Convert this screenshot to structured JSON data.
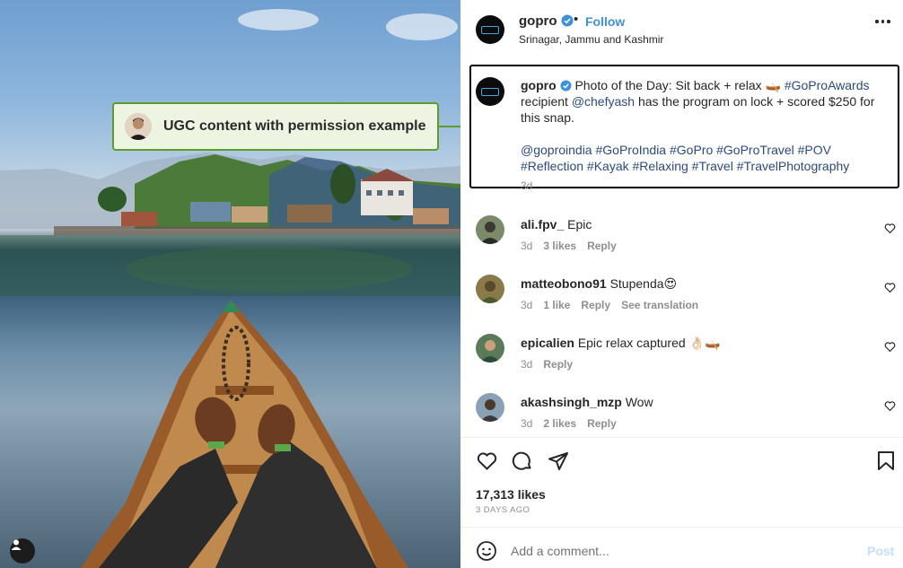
{
  "callout": {
    "text": "UGC content with permission example"
  },
  "post": {
    "username": "gopro",
    "follow_label": "Follow",
    "separator": "•",
    "location": "Srinagar, Jammu and Kashmir",
    "caption": {
      "username": "gopro",
      "text_1": "Photo of the Day: Sit back + relax",
      "emoji_1": "🛶",
      "tag_1": "#GoProAwards",
      "text_2": "recipient",
      "mention": "@chefyash",
      "text_3": "has the program on lock + scored $250 for this snap.",
      "tags_line_1": "@goproindia #GoProIndia #GoPro #GoProTravel #POV",
      "tags_line_2": "#Reflection #Kayak #Relaxing #Travel #TravelPhotography",
      "time": "3d"
    },
    "comments": [
      {
        "user": "ali.fpv_",
        "text": "Epic",
        "time": "3d",
        "likes": "3 likes",
        "reply": "Reply",
        "extra": ""
      },
      {
        "user": "matteobono91",
        "text": "Stupenda😍",
        "time": "3d",
        "likes": "1 like",
        "reply": "Reply",
        "extra": "See translation"
      },
      {
        "user": "epicalien",
        "text": "Epic relax captured 👌🏻🛶",
        "time": "3d",
        "likes": "",
        "reply": "Reply",
        "extra": ""
      },
      {
        "user": "akashsingh_mzp",
        "text": "Wow",
        "time": "3d",
        "likes": "2 likes",
        "reply": "Reply",
        "extra": ""
      }
    ],
    "likes_count": "17,313 likes",
    "date": "3 DAYS AGO",
    "add_comment_placeholder": "Add a comment...",
    "post_button": "Post"
  },
  "colors": {
    "accent_green": "#5e9c2c",
    "link_blue": "#3e92d8",
    "hashtag": "#2b4a7d"
  },
  "icons": [
    "more-icon",
    "verified-icon",
    "heart-icon",
    "comment-icon",
    "share-icon",
    "bookmark-icon",
    "emoji-icon",
    "user-badge-icon"
  ]
}
